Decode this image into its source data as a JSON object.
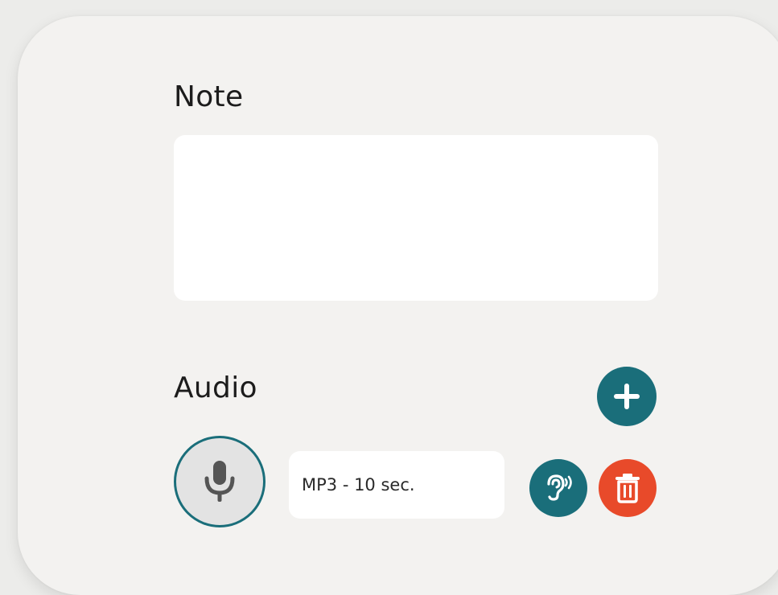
{
  "note": {
    "label": "Note",
    "value": "",
    "placeholder": ""
  },
  "audio": {
    "label": "Audio",
    "add_icon": "plus-icon",
    "record_icon": "microphone-icon",
    "file_text": "MP3 - 10 sec.",
    "listen_icon": "ear-listen-icon",
    "delete_icon": "trash-icon"
  },
  "colors": {
    "accent": "#1a6e7a",
    "danger": "#e84a2a",
    "card_bg": "#f3f2f0",
    "page_bg": "#ececea",
    "field_bg": "#ffffff"
  }
}
